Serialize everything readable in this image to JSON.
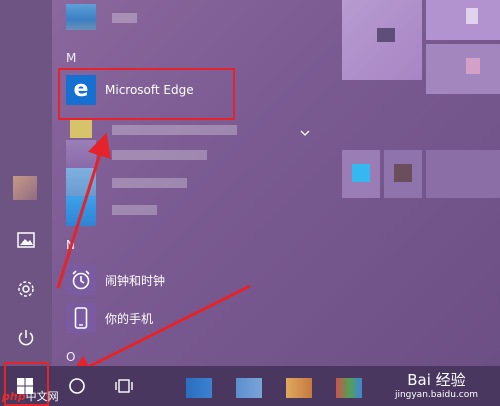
{
  "start_menu": {
    "sections": [
      {
        "letter": "M"
      },
      {
        "letter": "N"
      },
      {
        "letter": "O"
      }
    ],
    "apps": {
      "edge": {
        "label": "Microsoft Edge",
        "icon": "edge-icon"
      },
      "alarms": {
        "label": "闹钟和时钟",
        "icon": "alarm-clock-icon"
      },
      "phone": {
        "label": "你的手机",
        "icon": "phone-icon"
      }
    },
    "rail_icons": [
      "photos-icon",
      "settings-icon",
      "power-icon"
    ],
    "expand_icon": "chevron-down-icon"
  },
  "taskbar": {
    "items": [
      "windows-start-icon",
      "search-circle-icon",
      "task-view-icon"
    ]
  },
  "watermarks": {
    "php": "php",
    "php_suffix": "中文网",
    "baidu_main": "Bai 经验",
    "baidu_url": "jingyan.baidu.com"
  },
  "colors": {
    "highlight": "#e5232b",
    "edge_tile": "#1570d2",
    "phone_tile": "#7a5aa0"
  }
}
